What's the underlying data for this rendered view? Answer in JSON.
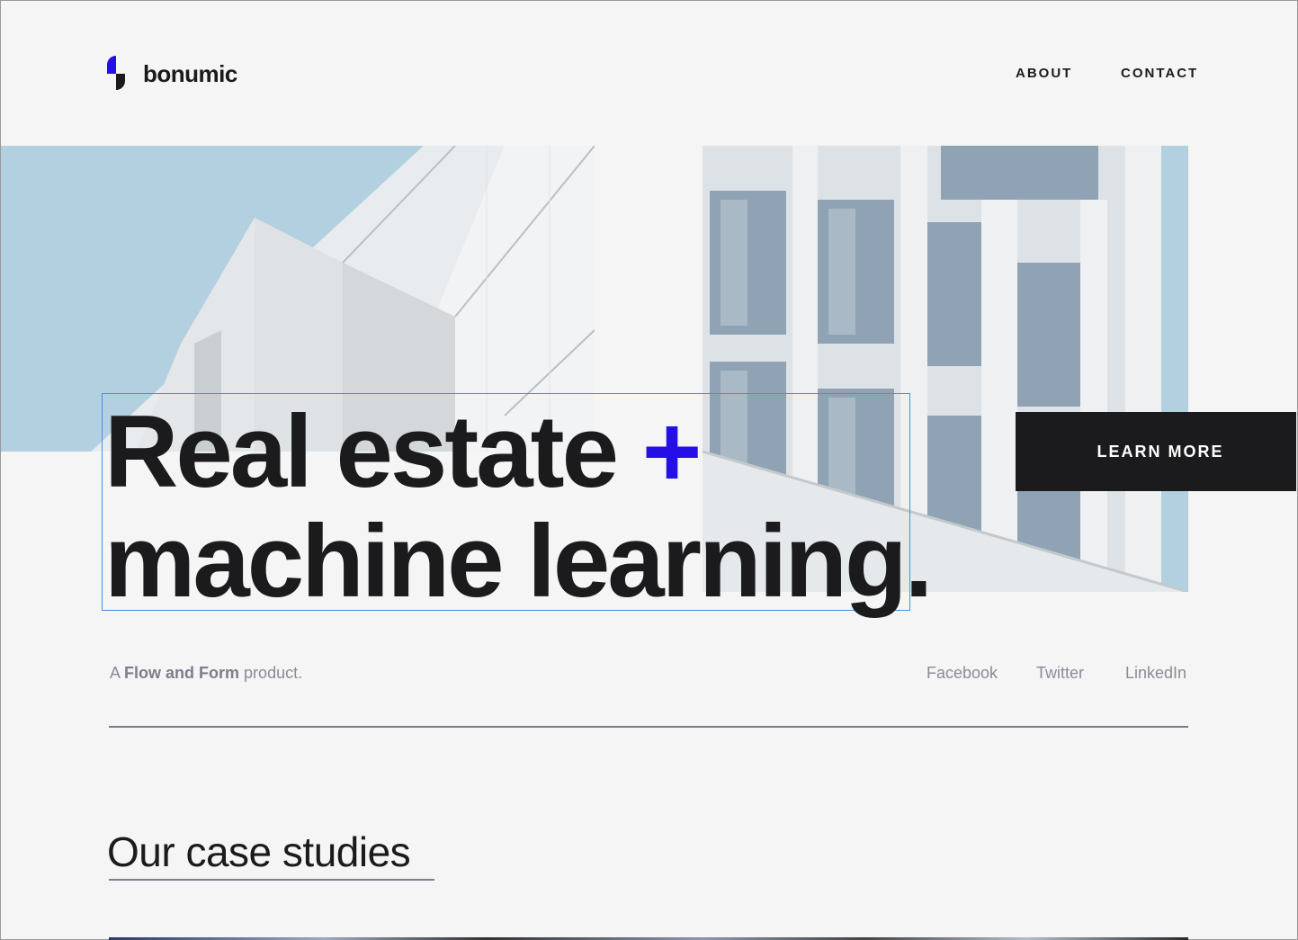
{
  "brand": {
    "name": "bonumic",
    "accent": "#2410e6",
    "dark": "#1b1b1d"
  },
  "nav": {
    "about": "ABOUT",
    "contact": "CONTACT"
  },
  "hero": {
    "line1": "Real estate",
    "plus": "+",
    "line2": "machine learning.",
    "cta": "LEARN MORE"
  },
  "product": {
    "prefix": "A",
    "name": "Flow and Form",
    "suffix": "product."
  },
  "social": [
    "Facebook",
    "Twitter",
    "LinkedIn"
  ],
  "case_studies": {
    "title": "Our case studies"
  }
}
